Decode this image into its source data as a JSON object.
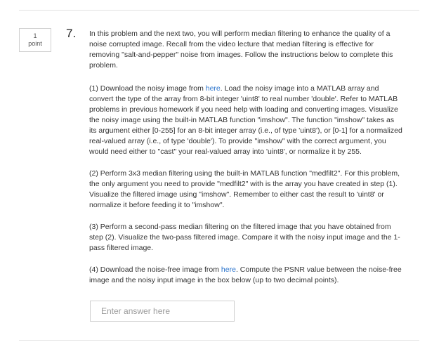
{
  "points": {
    "value": "1",
    "label": "point"
  },
  "question": {
    "number": "7.",
    "intro": "In this problem and the next two, you will perform median filtering to enhance the quality of a noise corrupted image. Recall from the video lecture that median filtering is effective for removing \"salt-and-pepper\" noise from images. Follow the instructions below to complete this problem.",
    "step1_prefix": "(1) Download the noisy image from ",
    "step1_link": "here",
    "step1_suffix": ". Load the noisy image into a MATLAB array and convert the type of the array from 8-bit integer 'uint8' to real number 'double'. Refer to MATLAB problems in previous homework if you need help with loading and converting images. Visualize the noisy image using the built-in MATLAB function \"imshow\". The function \"imshow\" takes as its argument either [0-255] for an 8-bit integer array (i.e., of type 'uint8'), or [0-1] for a normalized real-valued array (i.e., of type 'double'). To provide \"imshow\" with the correct argument, you would need either to \"cast\" your real-valued array into 'uint8', or normalize it by 255.",
    "step2": "(2) Perform 3x3 median filtering using the built-in MATLAB function \"medfilt2\". For this problem, the only argument you need to provide \"medfilt2\" with is the array you have created in step (1). Visualize the filtered image using \"imshow\". Remember to either cast the result to 'uint8' or normalize it before feeding it to \"imshow\".",
    "step3": "(3) Perform a second-pass median filtering on the filtered image that you have obtained from step (2). Visualize the two-pass filtered image. Compare it with the noisy input image and the 1-pass filtered image.",
    "step4_prefix": "(4) Download the noise-free image from ",
    "step4_link": "here",
    "step4_suffix": ". Compute the PSNR value between the noise-free image and the noisy input image in the box below (up to two decimal points)."
  },
  "answer": {
    "placeholder": "Enter answer here",
    "value": ""
  }
}
